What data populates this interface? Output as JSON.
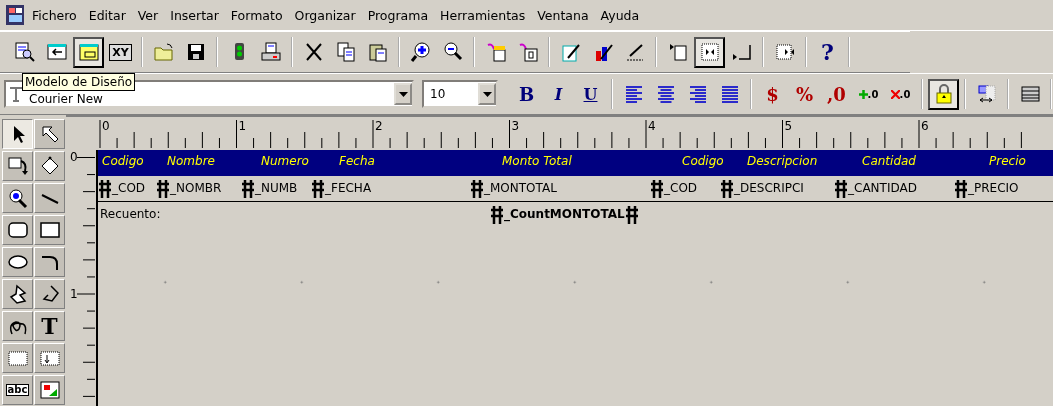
{
  "menu": [
    "Fichero",
    "Editar",
    "Ver",
    "Insertar",
    "Formato",
    "Organizar",
    "Programa",
    "Herramientas",
    "Ventana",
    "Ayuda"
  ],
  "main_toolbar": [
    [
      {
        "pressed": false
      },
      {
        "pressed": false
      },
      {
        "pressed": true
      },
      {
        "pressed": false,
        "label": "XY"
      }
    ],
    [
      {
        "pressed": false
      },
      {
        "pressed": false
      }
    ],
    [
      {
        "pressed": false
      },
      {
        "pressed": false
      }
    ],
    [
      {
        "pressed": false
      },
      {
        "pressed": false
      },
      {
        "pressed": false
      }
    ],
    [
      {
        "pressed": false
      },
      {
        "pressed": false
      }
    ],
    [
      {
        "pressed": false
      },
      {
        "pressed": false
      }
    ],
    [
      {
        "pressed": false
      },
      {
        "pressed": false
      },
      {
        "pressed": false
      }
    ],
    [
      {
        "pressed": false
      },
      {
        "pressed": true
      },
      {
        "pressed": false
      }
    ],
    [
      {
        "pressed": false
      }
    ],
    [
      {
        "pressed": false,
        "label": "?"
      }
    ]
  ],
  "tooltip": "Modelo de Diseño",
  "font_field": {
    "value": "Courier New"
  },
  "size_field": {
    "value": "10"
  },
  "format_toolbar": [
    [
      {
        "pressed": false,
        "label": "B"
      },
      {
        "pressed": false,
        "label": "I"
      },
      {
        "pressed": false,
        "label": "U"
      }
    ],
    [
      {
        "pressed": false
      },
      {
        "pressed": false
      },
      {
        "pressed": false
      },
      {
        "pressed": false
      }
    ],
    [
      {
        "pressed": false,
        "label": "$"
      },
      {
        "pressed": false,
        "label": "%"
      },
      {
        "pressed": false,
        "label": ",0"
      },
      {
        "pressed": false,
        "label": ".0"
      },
      {
        "pressed": false,
        "label": ".0"
      }
    ],
    [
      {
        "pressed": true
      }
    ],
    [
      {
        "pressed": false
      }
    ],
    [
      {
        "pressed": false
      }
    ]
  ],
  "palette": [
    {
      "selected": true
    },
    {
      "selected": false
    },
    {
      "selected": false
    },
    {
      "selected": false
    },
    {
      "selected": false
    },
    {
      "selected": false
    },
    {
      "selected": false
    },
    {
      "selected": false
    },
    {
      "selected": false
    },
    {
      "selected": false
    },
    {
      "selected": false
    },
    {
      "selected": false
    },
    {
      "selected": false
    },
    {
      "selected": false,
      "label": "T"
    },
    {
      "selected": false
    },
    {
      "selected": false
    },
    {
      "selected": false,
      "label": "abc"
    },
    {
      "selected": false
    }
  ],
  "ruler": {
    "labels": [
      "0",
      "1",
      "2",
      "3",
      "4",
      "5",
      "6"
    ]
  },
  "vertical_ruler": {
    "labels": [
      "0",
      "1"
    ]
  },
  "report": {
    "header": [
      "Codigo",
      "Nombre",
      "Numero",
      "Fecha",
      "Monto Total",
      "Codigo",
      "Descripcion",
      "Cantidad",
      "Precio"
    ],
    "detail": [
      "_COD",
      "_NOMBR",
      "_NUMB",
      "_FECHA",
      "_MONTOTAL",
      "_COD",
      "_DESCRIPCI",
      "_CANTIDAD",
      "_PRECIO"
    ],
    "summary_label": "Recuento:",
    "summary_field": "_CountMONTOTAL"
  }
}
